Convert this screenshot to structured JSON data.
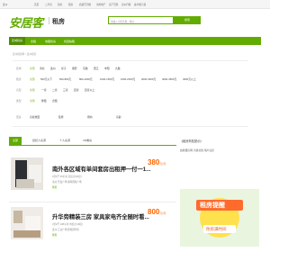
{
  "topbar": {
    "city": "连州",
    "links": [
      "首页",
      "二手房",
      "新房",
      "租房",
      "商铺写字楼",
      "海外地产",
      "房产百科",
      "房价行情",
      "客户端下载"
    ]
  },
  "header": {
    "logo": "安居客",
    "section": "租房",
    "search_placeholder": "请输入小区名称，地址...",
    "search_button": "搜索"
  },
  "nav": {
    "items": [
      "区域找房",
      "合租",
      "地图找房",
      "找回帖租"
    ]
  },
  "breadcrumb": "连州租房网 > 连州租房",
  "filters": {
    "area": {
      "label": "区域",
      "items": [
        "全部",
        "清北",
        "连州",
        "星子",
        "保安",
        "东陂",
        "西江",
        "丰阳",
        "九陂"
      ]
    },
    "price": {
      "label": "租金",
      "items": [
        "全部",
        "500元以下",
        "500-800元",
        "800-1000元",
        "1000-1500元",
        "1500-2000元",
        "2000-3000元",
        "3000-4500元",
        "4500元以上"
      ]
    },
    "room": {
      "label": "房型",
      "items": [
        "全部",
        "一室",
        "二室",
        "三室",
        "四室",
        "四室以上"
      ]
    },
    "type": {
      "label": "类型",
      "items": [
        "全部",
        "整租",
        "合租"
      ]
    },
    "more": {
      "label": "更多",
      "items": [
        "房屋类型",
        "装修",
        "朝向",
        "房龄"
      ]
    }
  },
  "tabs": [
    "全部",
    "经纪人房源",
    "个人房源",
    "VR看房"
  ],
  "listings": [
    {
      "title": "南外各区域有单间套房出租押一付一1...",
      "meta1": "3室1厅  35平米  高层(共30层)",
      "meta2": "清北  开发广场  保利国际广场",
      "tag": "整租",
      "price": "380",
      "unit": "元/月"
    },
    {
      "title": "升华旁精装三房 家具家电齐全随时看...",
      "meta1": "3室2厅  108平米  中层(共18层)",
      "meta2": "连州  万达广场  碧桂园华府",
      "tag": "整租",
      "price": "800",
      "unit": "元/月"
    }
  ],
  "sidebar": {
    "title": "《租房风险提示》",
    "line": "启航租房网 大额交钱 用户注意",
    "ad_text": "租房提醒",
    "ad_sub": "你房满时间"
  },
  "colors": {
    "brand": "#62ab00",
    "price": "#ff6600"
  }
}
